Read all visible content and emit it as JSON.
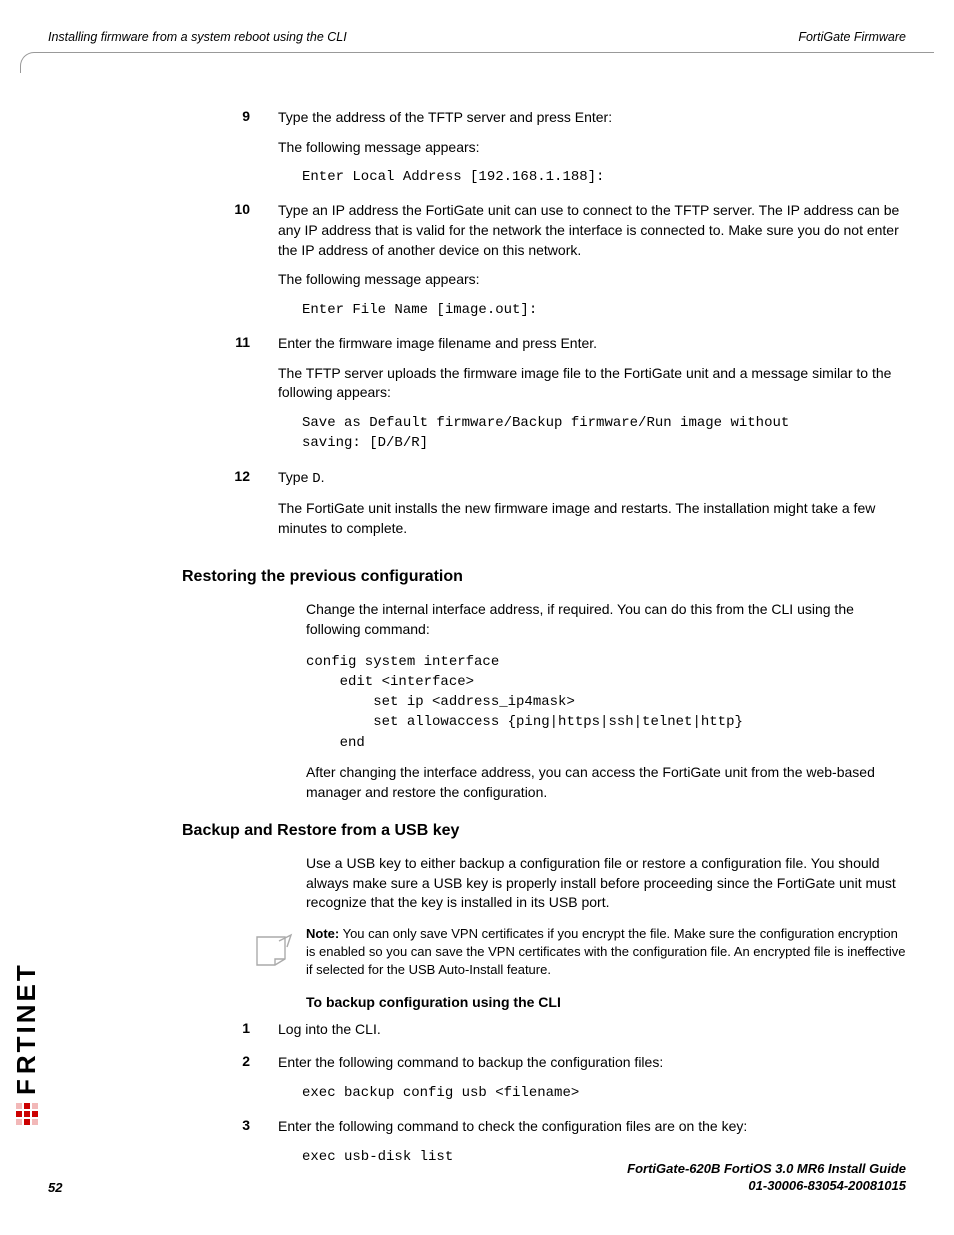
{
  "header": {
    "left": "Installing firmware from a system reboot using the CLI",
    "right": "FortiGate Firmware"
  },
  "steps_a": [
    {
      "num": "9",
      "paras": [
        "Type the address of the TFTP server and press Enter:",
        "The following message appears:"
      ],
      "code": "Enter Local Address [192.168.1.188]:"
    }
  ],
  "step10": {
    "num": "10",
    "p1": "Type an IP address the FortiGate unit can use to connect to the TFTP server. The IP address can be any IP address that is valid for the network the interface is connected to. Make sure you do not enter the IP address of another device on this network.",
    "p2": "The following message appears:",
    "code": "Enter File Name [image.out]:"
  },
  "step11": {
    "num": "11",
    "p1": "Enter the firmware image filename and press Enter.",
    "p2": "The TFTP server uploads the firmware image file to the FortiGate unit and a message similar to the following appears:",
    "code": "Save as Default firmware/Backup firmware/Run image without\nsaving: [D/B/R]"
  },
  "step12": {
    "num": "12",
    "p1a": "Type ",
    "p1code": "D",
    "p1b": ".",
    "p2": "The FortiGate unit installs the new firmware image and restarts. The installation might take a few minutes to complete."
  },
  "restoring": {
    "heading": "Restoring the previous configuration",
    "p1": "Change the internal interface address, if required. You can do this from the CLI using the following command:",
    "code": "config system interface\n    edit <interface>\n        set ip <address_ip4mask>\n        set allowaccess {ping|https|ssh|telnet|http}\n    end",
    "p2": "After changing the interface address, you can access the FortiGate unit from the web-based manager and restore the configuration."
  },
  "usb": {
    "heading": "Backup and Restore from a USB key",
    "p1": "Use a USB key to either backup a configuration file or restore a configuration file. You should always make sure a USB key is properly install before proceeding since the FortiGate unit must recognize that the key is installed in its USB port.",
    "note_label": "Note:",
    "note_text": " You can only save VPN certificates if you encrypt the file. Make sure the configuration encryption is enabled so you can save the VPN certificates with the configuration file. An encrypted file is ineffective if selected for the USB Auto-Install feature.",
    "sub_heading": "To backup configuration using the CLI",
    "steps": [
      {
        "num": "1",
        "p": "Log into the CLI."
      },
      {
        "num": "2",
        "p": "Enter the following command to backup the configuration files:",
        "code": "exec backup config usb <filename>"
      },
      {
        "num": "3",
        "p": "Enter the following command to check the configuration files are on the key:",
        "code": "exec usb-disk list"
      }
    ]
  },
  "footer": {
    "line1": "FortiGate-620B FortiOS 3.0 MR6 Install Guide",
    "line2": "01-30006-83054-20081015",
    "page": "52"
  },
  "logo_text": "RTINET"
}
